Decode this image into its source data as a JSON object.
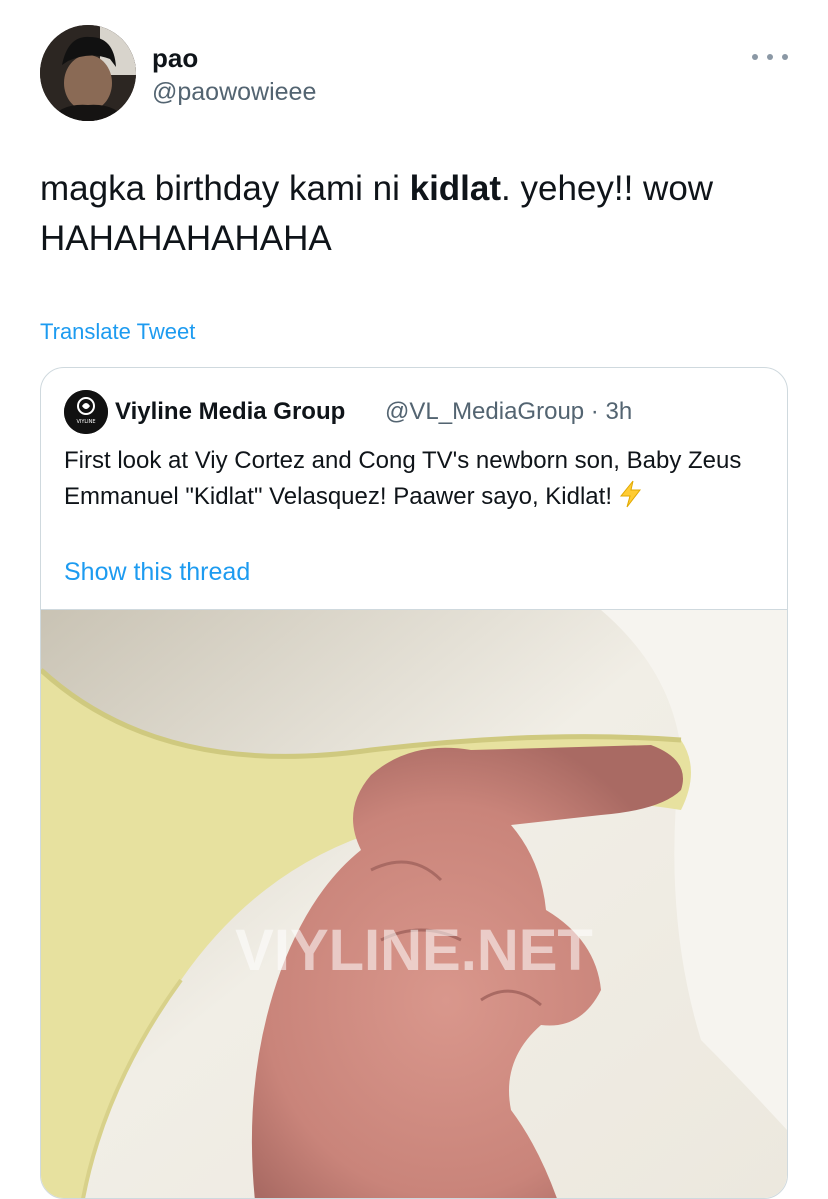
{
  "author": {
    "display_name": "pao",
    "handle": "@paowowieee"
  },
  "tweet": {
    "text_before": "magka birthday kami ni ",
    "text_bold": "kidlat",
    "text_after": ". yehey!! wow HAHAHAHAHAHA",
    "translate_label": "Translate Tweet"
  },
  "quote": {
    "display_name": "Viyline Media Group",
    "meta": "@VL_MediaGroup · 3h",
    "body": "First look at Viy Cortez and Cong TV's newborn son, Baby Zeus Emmanuel \"Kidlat\" Velasquez! Paawer sayo, Kidlat!",
    "thread_label": "Show this thread",
    "avatar_text": "VIYLINE",
    "photo_watermark": "VIYLINE.NET"
  },
  "icons": {
    "more": "more-dots-icon",
    "bolt": "lightning-bolt-icon"
  },
  "colors": {
    "link": "#1d9bf0",
    "secondary_text": "#536471",
    "border": "#cfd9de"
  }
}
